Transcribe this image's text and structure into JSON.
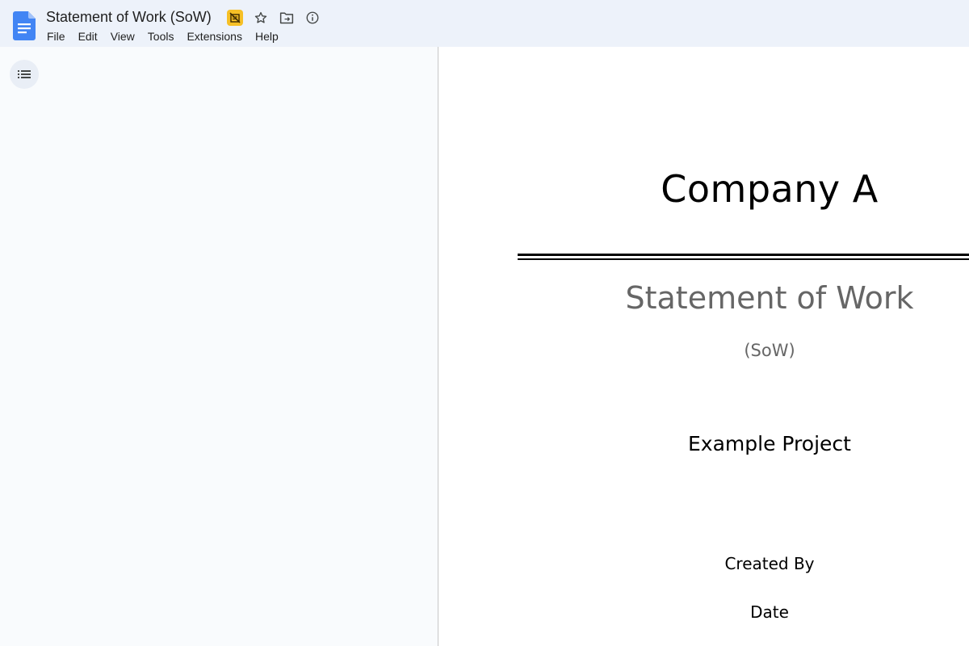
{
  "app": {
    "document_title": "Statement of Work (SoW)",
    "brand_color": "#4285f4",
    "offline_badge_color": "#f6c026"
  },
  "title_icons": [
    "offline-unavailable-icon",
    "star-icon",
    "move-folder-icon",
    "info-icon"
  ],
  "menu": {
    "items": [
      "File",
      "Edit",
      "View",
      "Tools",
      "Extensions",
      "Help"
    ]
  },
  "sidebar": {
    "outline_button_icon": "list-icon"
  },
  "document": {
    "company": "Company A",
    "heading": "Statement of Work",
    "subheading": "(SoW)",
    "project": "Example Project",
    "created_by": "Created By",
    "date": "Date"
  }
}
